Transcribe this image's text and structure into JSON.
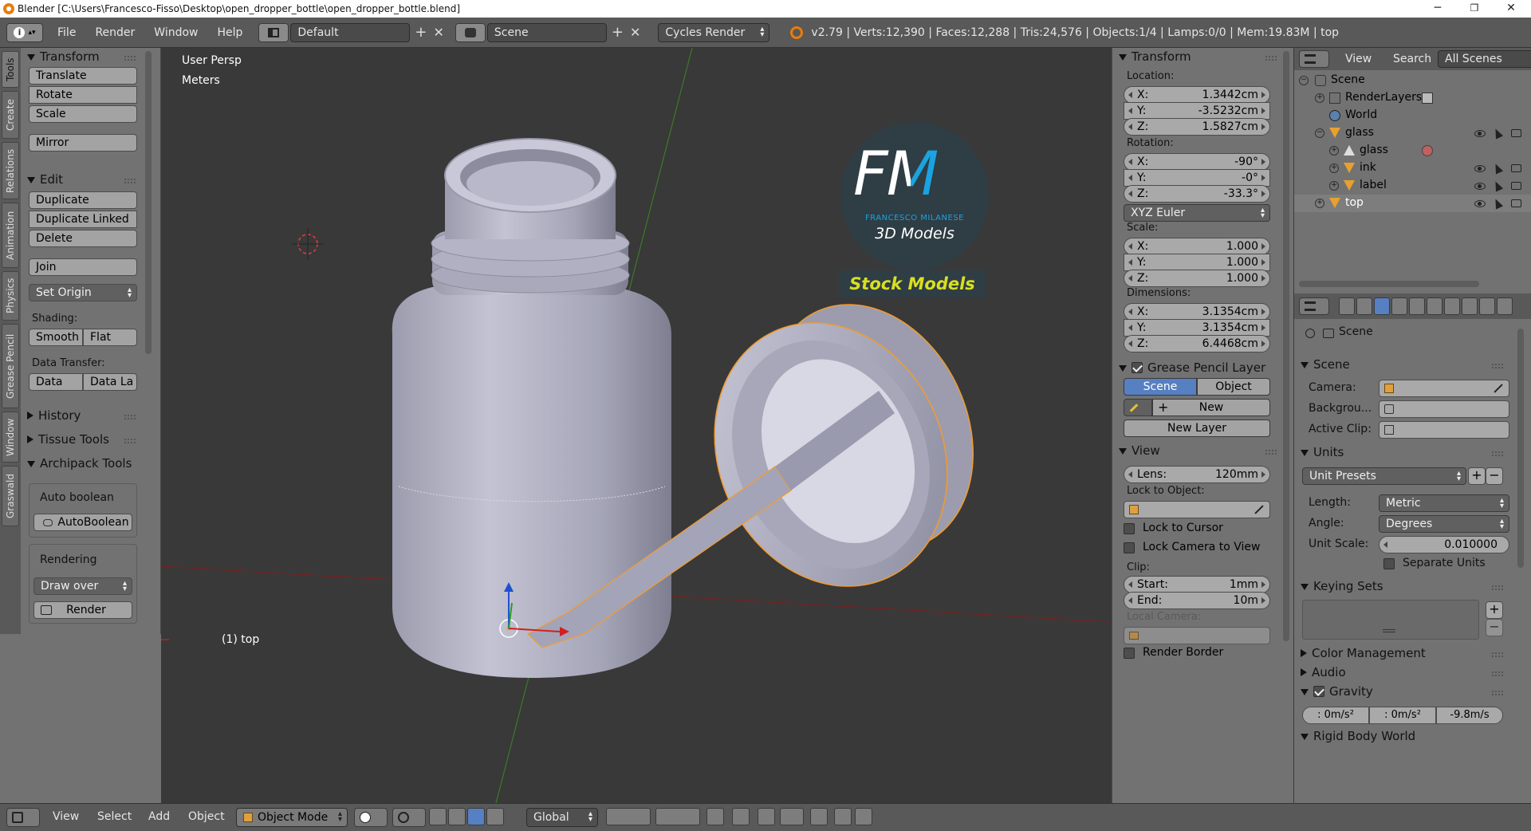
{
  "window": {
    "title": "Blender [C:\\Users\\Francesco-Fisso\\Desktop\\open_dropper_bottle\\open_dropper_bottle.blend]",
    "minimize": "─",
    "maximize": "❐",
    "close": "✕"
  },
  "info_header": {
    "menus": [
      "File",
      "Render",
      "Window",
      "Help"
    ],
    "screen_layout": "Default",
    "scene": "Scene",
    "render_engine": "Cycles Render",
    "stats": "v2.79 | Verts:12,390 | Faces:12,288 | Tris:24,576 | Objects:1/4 | Lamps:0/0 | Mem:19.83M | top"
  },
  "left_tabs": [
    "Tools",
    "Create",
    "Relations",
    "Animation",
    "Physics",
    "Grease Pencil",
    "Window",
    "Graswald"
  ],
  "toolshelf": {
    "transform": {
      "title": "Transform",
      "buttons": [
        "Translate",
        "Rotate",
        "Scale",
        "Mirror"
      ]
    },
    "edit": {
      "title": "Edit",
      "buttons": [
        "Duplicate",
        "Duplicate Linked",
        "Delete",
        "Join"
      ],
      "set_origin": "Set Origin",
      "shading_label": "Shading:",
      "smooth": "Smooth",
      "flat": "Flat",
      "data_transfer_label": "Data Transfer:",
      "data": "Data",
      "data_la": "Data La"
    },
    "history": "History",
    "tissue_tools": "Tissue Tools",
    "archipack": {
      "title": "Archipack Tools",
      "auto_boolean_label": "Auto boolean",
      "auto_boolean_button": "AutoBoolean",
      "rendering_label": "Rendering",
      "draw_over": "Draw over",
      "render_button": "Render"
    }
  },
  "viewport": {
    "view_name": "User Persp",
    "units": "Meters",
    "object_label": "(1) top",
    "watermark": {
      "letters": "FM",
      "name": "FRANCESCO MILANESE",
      "subtitle": "3D Models",
      "banner": "Stock Models"
    },
    "colors": {
      "bg": "#393939",
      "object": "#b3b3c4",
      "selection": "#f39b2c"
    }
  },
  "npanel": {
    "transform_title": "Transform",
    "location_label": "Location:",
    "location": [
      {
        "k": "X:",
        "v": "1.3442cm"
      },
      {
        "k": "Y:",
        "v": "-3.5232cm"
      },
      {
        "k": "Z:",
        "v": "1.5827cm"
      }
    ],
    "rotation_label": "Rotation:",
    "rotation": [
      {
        "k": "X:",
        "v": "-90°"
      },
      {
        "k": "Y:",
        "v": "-0°"
      },
      {
        "k": "Z:",
        "v": "-33.3°"
      }
    ],
    "rotation_mode": "XYZ Euler",
    "scale_label": "Scale:",
    "scale": [
      {
        "k": "X:",
        "v": "1.000"
      },
      {
        "k": "Y:",
        "v": "1.000"
      },
      {
        "k": "Z:",
        "v": "1.000"
      }
    ],
    "dimensions_label": "Dimensions:",
    "dimensions": [
      {
        "k": "X:",
        "v": "3.1354cm"
      },
      {
        "k": "Y:",
        "v": "3.1354cm"
      },
      {
        "k": "Z:",
        "v": "6.4468cm"
      }
    ],
    "grease_pencil_title": "Grease Pencil Layer",
    "gp_scene": "Scene",
    "gp_object": "Object",
    "gp_new": "New",
    "gp_new_layer": "New Layer",
    "view_title": "View",
    "lens_label": "Lens:",
    "lens_value": "120mm",
    "lock_to_object_label": "Lock to Object:",
    "lock_to_cursor": "Lock to Cursor",
    "lock_camera": "Lock Camera to View",
    "clip_label": "Clip:",
    "clip_start_label": "Start:",
    "clip_start_value": "1mm",
    "clip_end_label": "End:",
    "clip_end_value": "10m",
    "local_camera_label": "Local Camera:",
    "render_border": "Render Border"
  },
  "outliner": {
    "view": "View",
    "search": "Search",
    "filter": "All Scenes",
    "items": [
      "Scene",
      "RenderLayers",
      "World",
      "glass",
      "glass",
      "ink",
      "label",
      "top"
    ]
  },
  "properties": {
    "context_label": "Scene",
    "scene_title": "Scene",
    "camera_label": "Camera:",
    "background_label": "Backgrou...",
    "active_clip_label": "Active Clip:",
    "units_title": "Units",
    "unit_presets": "Unit Presets",
    "length_label": "Length:",
    "length_value": "Metric",
    "angle_label": "Angle:",
    "angle_value": "Degrees",
    "unit_scale_label": "Unit Scale:",
    "unit_scale_value": "0.010000",
    "separate_units": "Separate Units",
    "keying_sets_title": "Keying Sets",
    "color_management": "Color Management",
    "audio": "Audio",
    "gravity_title": "Gravity",
    "gravity": [
      ": 0m/s²",
      ": 0m/s²",
      "-9.8m/s"
    ],
    "rigid_body_world": "Rigid Body World"
  },
  "bottom_bar": {
    "menus": [
      "View",
      "Select",
      "Add",
      "Object"
    ],
    "mode": "Object Mode",
    "orientation": "Global"
  }
}
